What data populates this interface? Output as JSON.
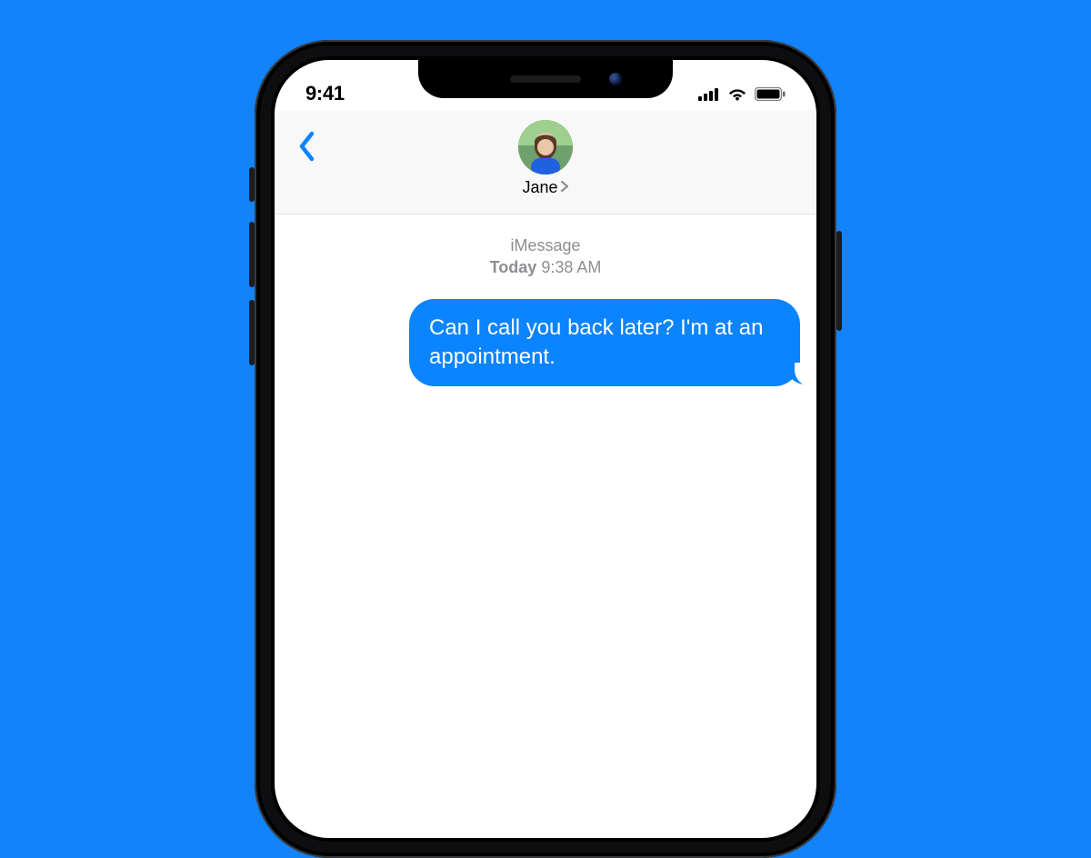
{
  "statusbar": {
    "time": "9:41"
  },
  "nav": {
    "contact_name": "Jane"
  },
  "thread": {
    "channel_label": "iMessage",
    "timestamp_prefix": "Today",
    "timestamp_time": "9:38 AM",
    "messages": [
      {
        "text": "Can I call you back later? I'm at an appointment."
      }
    ]
  }
}
